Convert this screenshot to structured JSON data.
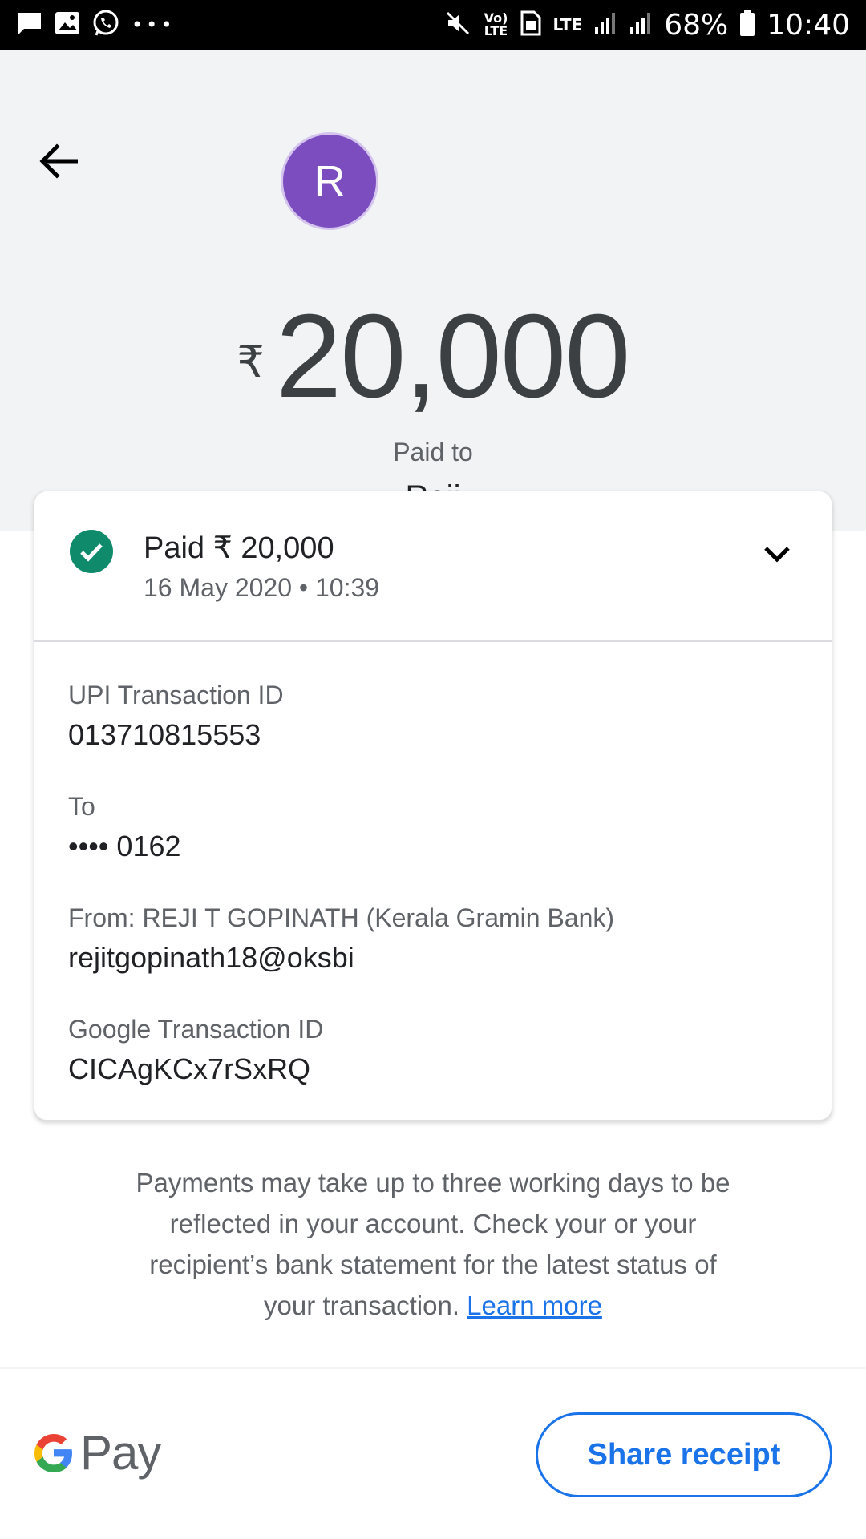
{
  "status_bar": {
    "time": "10:40",
    "battery": "68%",
    "network": "LTE",
    "volte": "Vo) LTE",
    "more": "•••"
  },
  "header": {
    "avatar_initial": "R",
    "currency_symbol": "₹",
    "amount": "20,000",
    "paid_to_label": "Paid to",
    "recipient_name": "Reji"
  },
  "card": {
    "status_title": "Paid ₹ 20,000",
    "status_date": "16 May 2020 • 10:39",
    "details": [
      {
        "label": "UPI Transaction ID",
        "value": "013710815553"
      },
      {
        "label": "To",
        "value": "•••• 0162"
      },
      {
        "label": "From: REJI T GOPINATH (Kerala Gramin Bank)",
        "value": "rejitgopinath18@oksbi"
      },
      {
        "label": "Google Transaction ID",
        "value": "CICAgKCx7rSxRQ"
      }
    ]
  },
  "note": {
    "text": "Payments may take up to three working days to be reflected in your account. Check your or your recipient’s bank statement for the latest status of your transaction. ",
    "link": "Learn more"
  },
  "footer": {
    "brand_text": "Pay",
    "share_label": "Share receipt"
  },
  "colors": {
    "accent": "#1a73e8",
    "success": "#0f8a6b",
    "avatar": "#7c4dbe",
    "header_bg": "#f1f3f4"
  }
}
